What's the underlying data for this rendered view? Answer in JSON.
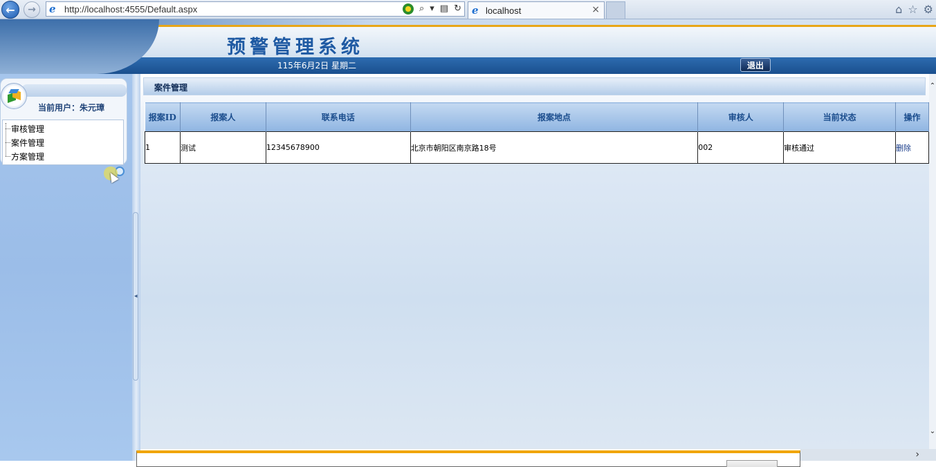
{
  "browser": {
    "url": "http://localhost:4555/Default.aspx",
    "tab_title": "localhost",
    "tab_close": "×"
  },
  "header": {
    "title": "预警管理系统",
    "date": "115年6月2日  星期二",
    "logout_label": "退出"
  },
  "sidebar": {
    "current_user": "当前用户：朱元璋",
    "menu": [
      {
        "label": "审核管理"
      },
      {
        "label": "案件管理"
      },
      {
        "label": "方案管理"
      }
    ]
  },
  "main": {
    "section_title": "案件管理",
    "table": {
      "headers": [
        "报案ID",
        "报案人",
        "联系电话",
        "报案地点",
        "审核人",
        "当前状态",
        "操作"
      ],
      "rows": [
        {
          "id": "1",
          "reporter": "测试",
          "phone": "12345678900",
          "location": "北京市朝阳区南京路18号",
          "reviewer": "002",
          "status": "审核通过",
          "action": "删除"
        }
      ]
    }
  },
  "colors": {
    "accent": "#1f5aa3",
    "header_bar": "#1a4f8e",
    "gold": "#e8a617",
    "sidebar": "#a5c5ec"
  }
}
